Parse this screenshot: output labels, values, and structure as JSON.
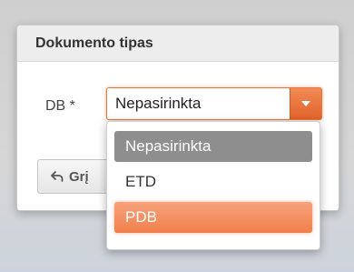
{
  "dialog": {
    "title": "Dokumento tipas"
  },
  "field": {
    "label": "DB *",
    "selected_value": "Nepasirinkta"
  },
  "back_button": {
    "label": "Grį"
  },
  "dropdown": {
    "options": [
      {
        "label": "Nepasirinkta",
        "state": "selected"
      },
      {
        "label": "ETD",
        "state": "normal"
      },
      {
        "label": "PDB",
        "state": "hover"
      }
    ]
  },
  "colors": {
    "accent": "#e8743b",
    "selected_option": "#8e8e8e",
    "header_bg": "#ededed"
  },
  "icons": {
    "back": "back-arrow-icon",
    "dropdown": "chevron-down-icon"
  }
}
